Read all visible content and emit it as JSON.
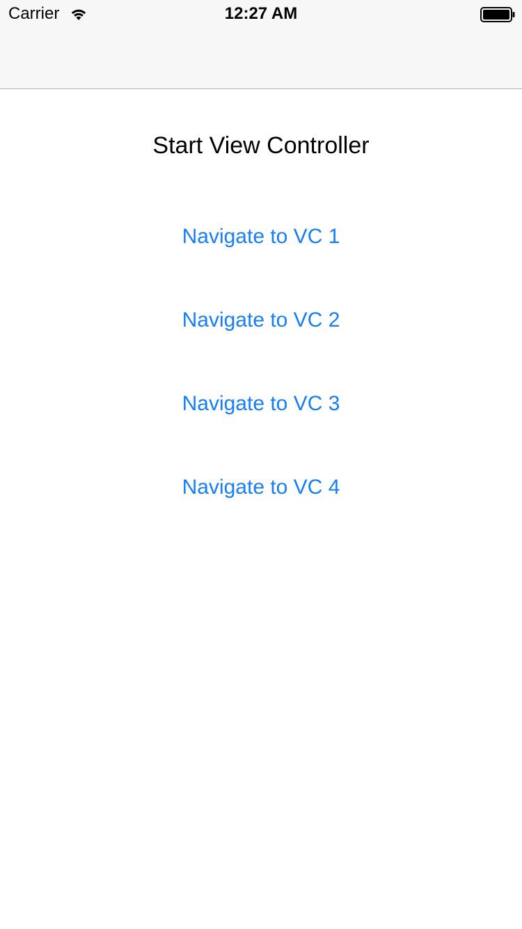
{
  "status_bar": {
    "carrier": "Carrier",
    "time": "12:27 AM",
    "wifi_icon": "wifi-icon",
    "battery_icon": "battery-full-icon"
  },
  "page": {
    "title": "Start View Controller"
  },
  "buttons": [
    {
      "label": "Navigate to VC 1"
    },
    {
      "label": "Navigate to VC 2"
    },
    {
      "label": "Navigate to VC 3"
    },
    {
      "label": "Navigate to VC 4"
    }
  ],
  "colors": {
    "accent": "#147efb",
    "bar_background": "#f7f7f7",
    "bar_separator": "#b2b2b2"
  }
}
